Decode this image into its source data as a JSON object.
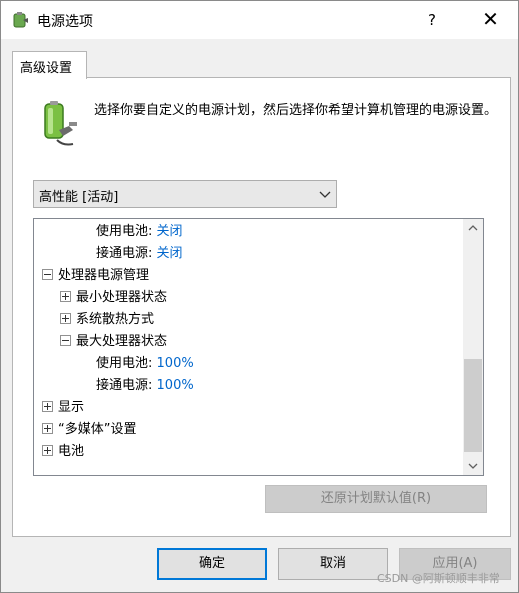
{
  "window": {
    "title": "电源选项",
    "help": "?",
    "close": "✕"
  },
  "tabs": [
    {
      "label": "高级设置"
    }
  ],
  "description": "选择你要自定义的电源计划，然后选择你希望计算机管理的电源设置。",
  "plan_select": {
    "value": "高性能 [活动]"
  },
  "tree": {
    "rows": [
      {
        "label": "使用电池:",
        "value": "关闭"
      },
      {
        "label": "接通电源:",
        "value": "关闭"
      },
      {
        "label": "处理器电源管理",
        "expander": "-"
      },
      {
        "label": "最小处理器状态",
        "expander": "+"
      },
      {
        "label": "系统散热方式",
        "expander": "+"
      },
      {
        "label": "最大处理器状态",
        "expander": "-"
      },
      {
        "label": "使用电池:",
        "value": "100%"
      },
      {
        "label": "接通电源:",
        "value": "100%"
      },
      {
        "label": "显示",
        "expander": "+"
      },
      {
        "label": "“多媒体”设置",
        "expander": "+"
      },
      {
        "label": "电池",
        "expander": "+"
      }
    ]
  },
  "buttons": {
    "restore": "还原计划默认值(R)",
    "ok": "确定",
    "cancel": "取消",
    "apply": "应用(A)"
  },
  "watermark": "CSDN @阿斯顿顺丰非常",
  "colors": {
    "link": "#0066cc",
    "focus_border": "#0078d7"
  }
}
